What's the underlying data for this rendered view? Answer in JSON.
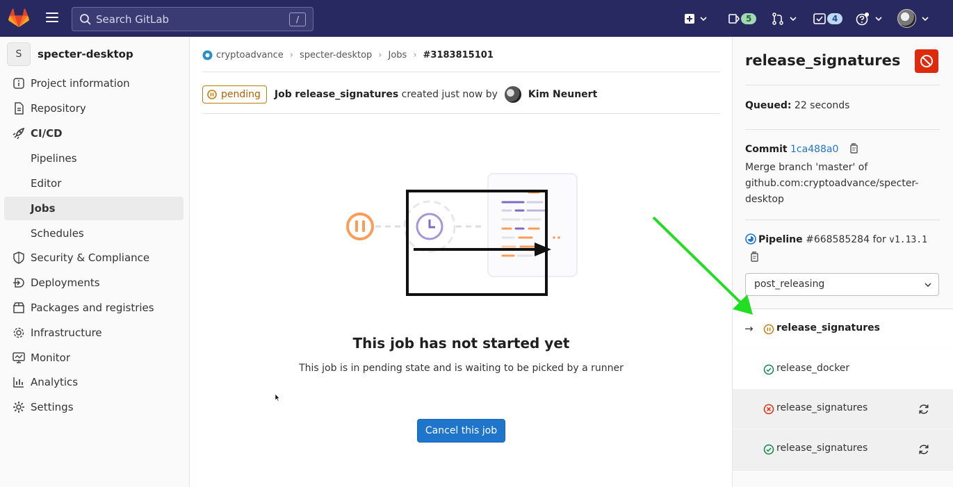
{
  "nav": {
    "search_placeholder": "Search GitLab",
    "search_shortcut": "/",
    "merge_requests_count": "5",
    "todos_count": "4"
  },
  "sidebar": {
    "project_initial": "S",
    "project_name": "specter-desktop",
    "items": [
      {
        "label": "Project information",
        "icon": "info-icon"
      },
      {
        "label": "Repository",
        "icon": "doc-icon"
      },
      {
        "label": "CI/CD",
        "icon": "rocket-icon"
      },
      {
        "label": "Pipelines"
      },
      {
        "label": "Editor"
      },
      {
        "label": "Jobs"
      },
      {
        "label": "Schedules"
      },
      {
        "label": "Security & Compliance",
        "icon": "shield-icon"
      },
      {
        "label": "Deployments",
        "icon": "deploy-icon"
      },
      {
        "label": "Packages and registries",
        "icon": "package-icon"
      },
      {
        "label": "Infrastructure",
        "icon": "cloud-icon"
      },
      {
        "label": "Monitor",
        "icon": "monitor-icon"
      },
      {
        "label": "Analytics",
        "icon": "chart-icon"
      },
      {
        "label": "Settings",
        "icon": "gear-icon"
      }
    ]
  },
  "breadcrumb": {
    "group": "cryptoadvance",
    "project": "specter-desktop",
    "section": "Jobs",
    "current": "#3183815101"
  },
  "job_header": {
    "status": "pending",
    "prefix": "Job",
    "name": "release_signatures",
    "suffix": "created just now by",
    "author": "Kim Neunert"
  },
  "empty_state": {
    "title": "This job has not started yet",
    "description": "This job is in pending state and is waiting to be picked by a runner",
    "cancel_label": "Cancel this job"
  },
  "right_sidebar": {
    "title": "release_signatures",
    "queued_label": "Queued:",
    "queued_value": "22 seconds",
    "commit_label": "Commit",
    "commit_sha": "1ca488a0",
    "commit_msg_1": "Merge branch 'master' of",
    "commit_msg_2": "github.com:cryptoadvance/specter-",
    "commit_msg_3": "desktop",
    "pipeline_label": "Pipeline",
    "pipeline_id": "#668585284",
    "pipeline_for": "for",
    "pipeline_ref": "v1.13.1",
    "stage": "post_releasing",
    "jobs": [
      {
        "name": "release_signatures",
        "status": "pending",
        "current": true
      },
      {
        "name": "release_docker",
        "status": "success"
      },
      {
        "name": "release_signatures",
        "status": "failed"
      },
      {
        "name": "release_signatures",
        "status": "success"
      }
    ]
  },
  "colors": {
    "navbar": "#292961",
    "pending": "#c17d10",
    "success": "#108548",
    "failed": "#dd2b0e",
    "primary": "#1f75cb",
    "annotation": "#22dd22"
  }
}
